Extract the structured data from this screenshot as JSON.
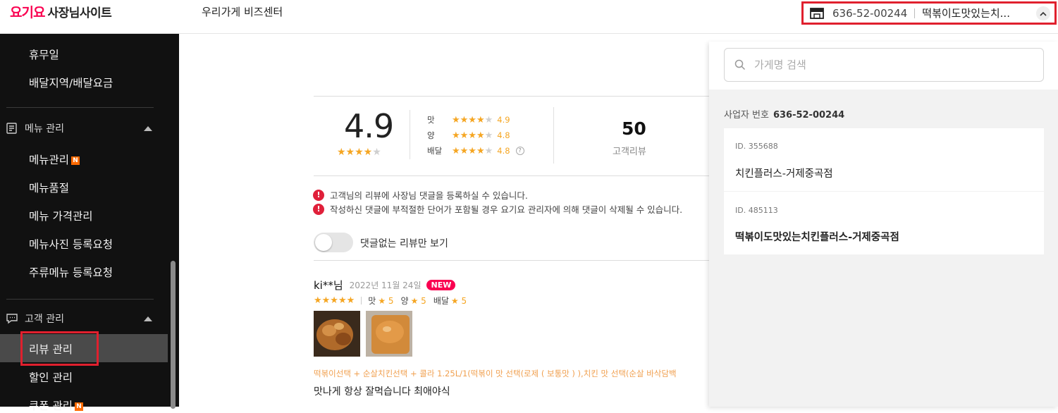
{
  "header": {
    "logo_brand": "요기요",
    "logo_site": "사장님사이트",
    "center_title": "우리가게 비즈센터",
    "selector_business_no": "636-52-00244",
    "selector_store_name": "떡볶이도맛있는치..."
  },
  "sidebar": {
    "items_top": [
      {
        "label": "휴무일"
      },
      {
        "label": "배달지역/배달요금"
      }
    ],
    "menu_section": {
      "title": "메뉴 관리",
      "items": [
        {
          "label": "메뉴관리",
          "badge": "N"
        },
        {
          "label": "메뉴품절"
        },
        {
          "label": "메뉴 가격관리"
        },
        {
          "label": "메뉴사진 등록요청"
        },
        {
          "label": "주류메뉴 등록요청"
        }
      ]
    },
    "customer_section": {
      "title": "고객 관리",
      "items": [
        {
          "label": "리뷰 관리"
        },
        {
          "label": "할인 관리"
        },
        {
          "label": "쿠폰 관리",
          "badge": "N"
        }
      ]
    }
  },
  "rating": {
    "overall": "4.9",
    "overall_stars": 4,
    "sub": [
      {
        "label": "맛",
        "value": "4.9",
        "stars": 4
      },
      {
        "label": "양",
        "value": "4.8",
        "stars": 4
      },
      {
        "label": "배달",
        "value": "4.8",
        "stars": 4
      }
    ],
    "review_count": "50",
    "review_count_label": "고객리뷰"
  },
  "notices": [
    "고객님의 리뷰에 사장님 댓글을 등록하실 수 있습니다.",
    "작성하신 댓글에 부적절한 단어가 포함될 경우 요기요 관리자에 의해 댓글이 삭제될 수 있습니다."
  ],
  "toggle": {
    "label": "댓글없는 리뷰만 보기",
    "on": false
  },
  "review": {
    "name": "ki**님",
    "date": "2022년 11월 24일",
    "new_badge": "NEW",
    "stars": 5,
    "scores": [
      {
        "label": "맛",
        "value": "5"
      },
      {
        "label": "양",
        "value": "5"
      },
      {
        "label": "배달",
        "value": "5"
      }
    ],
    "order": "떡볶이선택 + 순살치킨선택 + 콜라 1.25L/1(떡볶이 맛 선택(로제 ( 보통맛 ) ),치킨 맛 선택(순살 바삭담백",
    "text": "맛나게 항상 잘먹습니다 최애야식"
  },
  "dropdown": {
    "search_placeholder": "가게명 검색",
    "biz_label": "사업자 번호",
    "biz_no": "636-52-00244",
    "stores": [
      {
        "id": "ID. 355688",
        "name": "치킨플러스-거제중곡점",
        "bold": false
      },
      {
        "id": "ID. 485113",
        "name": "떡볶이도맛있는치킨플러스-거제중곡점",
        "bold": true
      }
    ]
  },
  "colors": {
    "brand": "#fa0050",
    "star": "#f5a623",
    "highlight": "#e0202e",
    "sidebar_bg": "#111111"
  }
}
